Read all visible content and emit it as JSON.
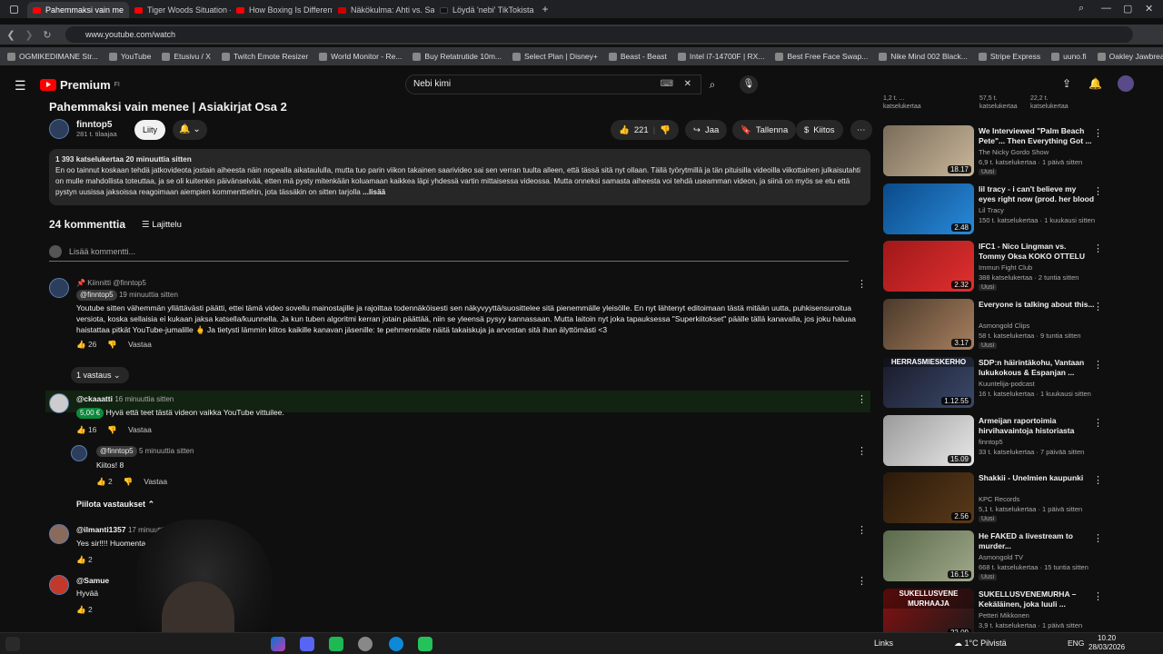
{
  "browser": {
    "tabs": [
      {
        "label": "Pahemmaksi vain me",
        "active": true
      },
      {
        "label": "Tiger Woods Situation - Yo",
        "active": false
      },
      {
        "label": "How Boxing Is Different Fr",
        "active": false
      },
      {
        "label": "Näkökulma: Ahti vs. Sann",
        "active": false
      },
      {
        "label": "Löydä 'nebi' TikTokista | Ti",
        "active": false
      }
    ],
    "url": "www.youtube.com/watch",
    "bookmarks": [
      "OGMIKEDIMANE Str...",
      "YouTube",
      "Etusivu / X",
      "Twitch Emote Resizer",
      "World Monitor - Re...",
      "Buy Retatrutide 10m...",
      "Select Plan | Disney+",
      "Beast - Beast",
      "Intel i7-14700F | RX...",
      "Best Free Face Swap...",
      "Nike Mind 002 Black...",
      "Stripe Express",
      "uuno.fi",
      "Oakley Jawbreaker P..."
    ]
  },
  "youtube": {
    "brand": "Premium",
    "region": "FI",
    "search_value": "Nebi kimi"
  },
  "video": {
    "title": "Pahemmaksi vain menee | Asiakirjat Osa 2",
    "channel": "finntop5",
    "subscribers": "281 t. tilaajaa",
    "subscribe_label": "Liity",
    "likes": "221",
    "share": "Jaa",
    "save": "Tallenna",
    "thanks": "Kiitos",
    "desc_meta": "1 393 katselukertaa  20 minuuttia sitten",
    "description": "En oo tainnut koskaan tehdä jatkovideota jostain aiheesta näin nopealla aikataululla, mutta tuo parin viikon takainen saarivideo sai sen verran tuulta alleen, että tässä sitä nyt ollaan. Tällä työrytmillä ja tän pituisilla videoilla viikottainen julkaisutahti on mulle mahdollista toteuttaa, ja se oli kuitenkin päivänselvää, etten mä pysty mitenkään koluamaan kaikkea läpi yhdessä vartin mittaisessa videossa. Mutta onneksi samasta aiheesta voi tehdä useamman videon, ja siinä on myös se etu että pystyn uusissa jaksoissa reagoimaan aiempien kommenttiehin, jota tässäkin on sitten tarjolla",
    "more": "...lisää"
  },
  "comments": {
    "count": "24 kommenttia",
    "sort": "Lajittelu",
    "add_placeholder": "Lisää kommentti...",
    "items": [
      {
        "pinned": "Kiinnitti @finntop5",
        "handle": "@finntop5",
        "time": "19 minuuttia sitten",
        "text": "Youtube sitten vähemmän yllättävästi päätti, ettei tämä video sovellu mainostajille ja rajoittaa todennäköisesti sen näkyvyyttä/suosittelee sitä pienemmälle yleisölle. En nyt lähtenyt editoimaan tästä mitään uutta, puhkisensuroitua versiota, koska sellaisia ei kukaan jaksa katsella/kuunnella. Ja kun tuben algoritmi kerran jotain päättää, niin se yleensä pysyy kannassaan. Mutta laitoin nyt joka tapauksessa \"Superkiitokset\" päälle tällä kanavalla, jos joku haluaa haistattaa pitkät YouTube-jumalille 🖕 Ja tietysti lämmin kiitos kaikille kanavan jäsenille: te pehmennätte näitä takaiskuja ja arvostan sitä ihan älyttömästi <3",
        "likes": "26",
        "reply": "Vastaa",
        "replies_label": "1 vastaus"
      },
      {
        "handle": "@ckaaatti",
        "time": "16 minuuttia sitten",
        "tip": "5,00 €",
        "text": "Hyvä että teet tästä videon vaikka YouTube vittuilee.",
        "likes": "16",
        "reply": "Vastaa"
      },
      {
        "handle": "@finntop5",
        "time": "5 minuuttia sitten",
        "text": "Kiitos! 8",
        "likes": "2",
        "reply": "Vastaa"
      },
      {
        "hide_label": "Piilota vastaukset"
      },
      {
        "handle": "@ilmanti1357",
        "time": "17 minuuttia sitten",
        "text": "Yes sir!!!! Huomenta",
        "likes": "2"
      },
      {
        "handle": "@Samue",
        "text": "Hyvää",
        "likes": "2"
      }
    ]
  },
  "sidebar": {
    "top_cut": [
      [
        "1,2 t. ...",
        "katselukertaa"
      ],
      [
        "57,5 t.",
        "katselukertaa"
      ],
      [
        "22,2 t.",
        "katselukertaa"
      ]
    ],
    "videos": [
      {
        "title": "We Interviewed \"Palm Beach Pete\"... Then Everything Got ...",
        "channel": "The Nicky Gordo Show",
        "meta": "6,9 t. katselukertaa · 1 päivä sitten",
        "badge": "Uusi",
        "duration": "18.17",
        "c1": "#7a6c5a",
        "c2": "#c9b79a"
      },
      {
        "title": "lil tracy - i can't believe my eyes right now (prod. her blood 🩸)",
        "channel": "Lil Tracy",
        "meta": "150 t. katselukertaa · 1 kuukausi sitten",
        "badge": "",
        "duration": "2.48",
        "c1": "#0a4a8a",
        "c2": "#2a8ad8"
      },
      {
        "title": "IFC1 - Nico Lingman vs. Tommy Oksa KOKO OTTELU",
        "channel": "Immun Fight Club",
        "meta": "388 katselukertaa · 2 tuntia sitten",
        "badge": "Uusi",
        "duration": "2.32",
        "c1": "#a01818",
        "c2": "#e03030"
      },
      {
        "title": "Everyone is talking about this...",
        "channel": "Asmongold Clips",
        "meta": "58 t. katselukertaa · 9 tuntia sitten",
        "badge": "Uusi",
        "duration": "3.17",
        "c1": "#4a3a2a",
        "c2": "#a88060"
      },
      {
        "title": "SDP:n häirintäkohu, Vantaan lukukokous & Espanjan ...",
        "channel": "Kuuntelija-podcast",
        "meta": "16 t. katselukertaa · 1 kuukausi sitten",
        "badge": "",
        "duration": "1.12.55",
        "c1": "#1a1a2a",
        "c2": "#3a4a6a",
        "label": "HERRASMIESKERHO"
      },
      {
        "title": "Armeijan raportoimia hirvihavaintoja historiasta",
        "channel": "finntop5",
        "meta": "33 t. katselukertaa · 7 päivää sitten",
        "badge": "",
        "duration": "15.09",
        "c1": "#9a9a9a",
        "c2": "#e8e8e8"
      },
      {
        "title": "Shakkii - Unelmien kaupunki",
        "channel": "KPC Records",
        "meta": "5,1 t. katselukertaa · 1 päivä sitten",
        "badge": "Uusi",
        "duration": "2.56",
        "c1": "#2a1a0a",
        "c2": "#5a3a1a"
      },
      {
        "title": "He FAKED a livestream to murder...",
        "channel": "Asmongold TV",
        "meta": "668 t. katselukertaa · 15 tuntia sitten",
        "badge": "Uusi",
        "duration": "16.15",
        "c1": "#5a6a4a",
        "c2": "#a0a88a"
      },
      {
        "title": "SUKELLUSVENEMURHA – Kekäläinen, joka luuli ...",
        "channel": "Petteri Mikkonen",
        "meta": "3,9 t. katselukertaa · 1 päivä sitten",
        "badge": "",
        "duration": "22.09",
        "c1": "#8a1010",
        "c2": "#1a1a1a",
        "label": "SUKELLUSVENE MURHAAJA"
      }
    ]
  },
  "taskbar": {
    "links": "Links",
    "weather": "1°C Pilvistä",
    "lang": "ENG",
    "time": "10.20",
    "date": "28/03/2026"
  }
}
